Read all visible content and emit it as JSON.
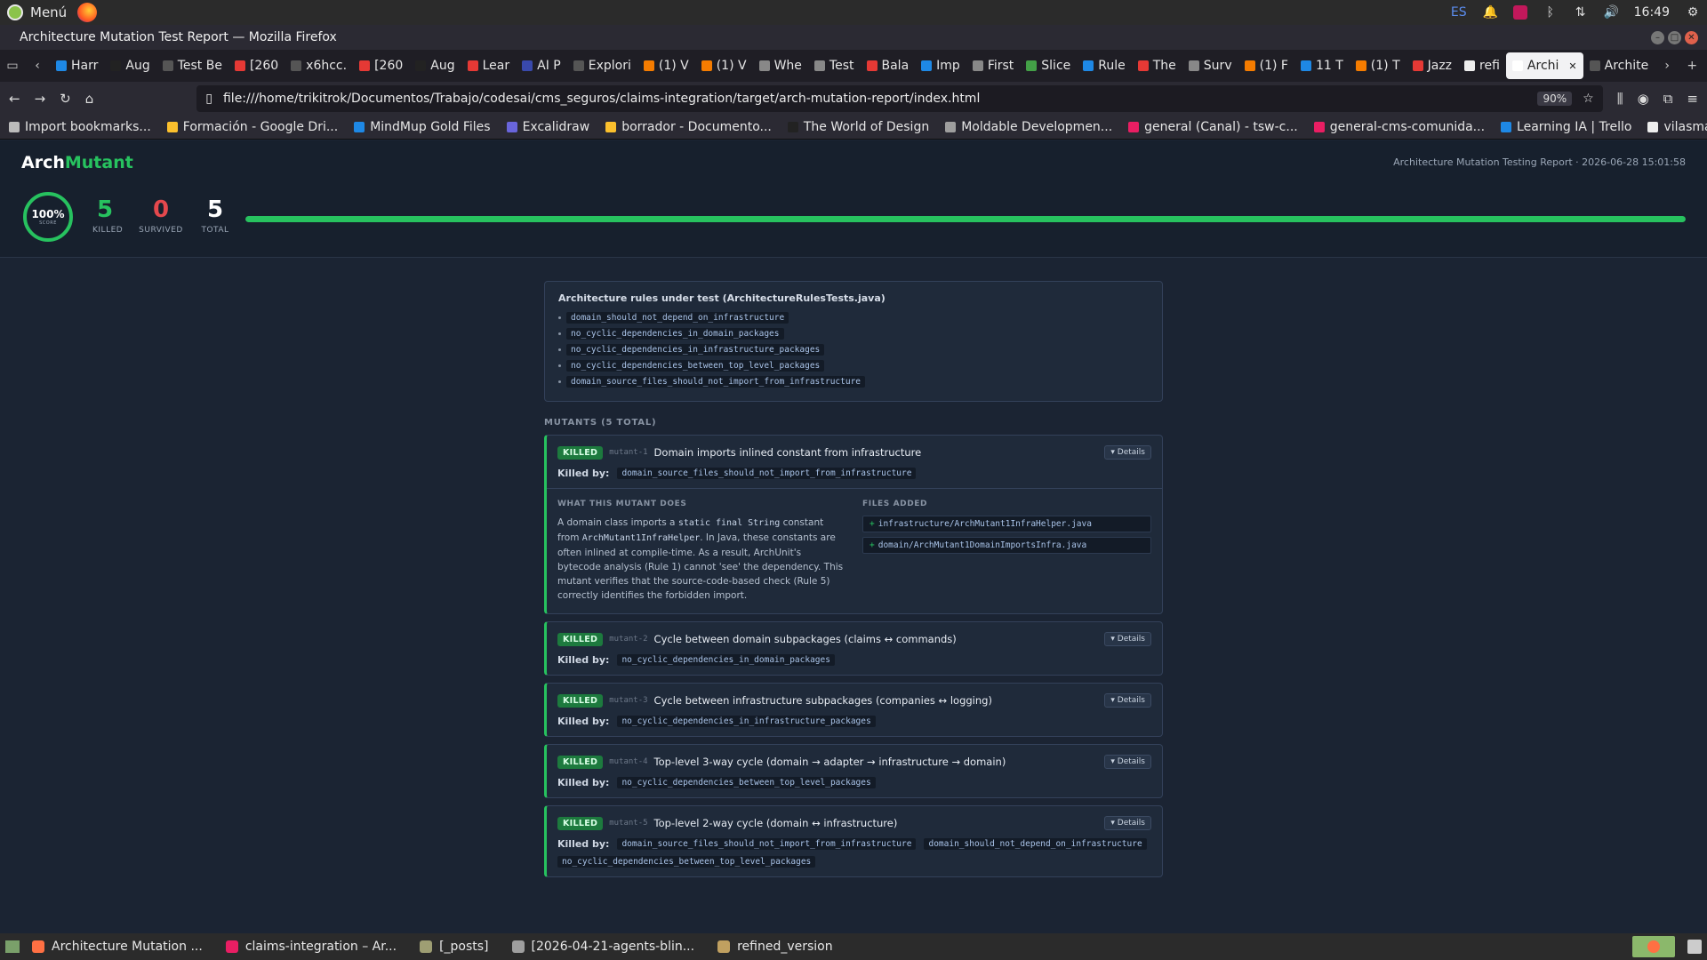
{
  "system": {
    "menu_label": "Menú",
    "keyboard_lang": "ES",
    "clock": "16:49"
  },
  "window": {
    "title": "Architecture Mutation Test Report — Mozilla Firefox"
  },
  "tabs": [
    {
      "label": "Harr",
      "color": "#1e88e5"
    },
    {
      "label": "Aug",
      "color": "#222222"
    },
    {
      "label": "Test Be",
      "color": "#555555"
    },
    {
      "label": "[260",
      "color": "#e53935"
    },
    {
      "label": "x6hcc.",
      "color": "#555555"
    },
    {
      "label": "[260",
      "color": "#e53935"
    },
    {
      "label": "Aug",
      "color": "#222222"
    },
    {
      "label": "Lear",
      "color": "#e53935"
    },
    {
      "label": "AI P",
      "color": "#3949ab"
    },
    {
      "label": "Explori",
      "color": "#555555"
    },
    {
      "label": "(1) V",
      "color": "#f57c00"
    },
    {
      "label": "(1) V",
      "color": "#f57c00"
    },
    {
      "label": "Whe",
      "color": "#888888"
    },
    {
      "label": "Test",
      "color": "#888888"
    },
    {
      "label": "Bala",
      "color": "#e53935"
    },
    {
      "label": "Imp",
      "color": "#1e88e5"
    },
    {
      "label": "First",
      "color": "#888888"
    },
    {
      "label": "Slice",
      "color": "#43a047"
    },
    {
      "label": "Rule",
      "color": "#1e88e5"
    },
    {
      "label": "The",
      "color": "#e53935"
    },
    {
      "label": "Surv",
      "color": "#888888"
    },
    {
      "label": "(1) F",
      "color": "#f57c00"
    },
    {
      "label": "11 T",
      "color": "#1e88e5"
    },
    {
      "label": "(1) T",
      "color": "#f57c00"
    },
    {
      "label": "Jazz",
      "color": "#e53935"
    },
    {
      "label": "refi",
      "color": "#eeeeee"
    },
    {
      "label": "Archi",
      "color": "#ffffff",
      "active": true
    },
    {
      "label": "Archite",
      "color": "#555555"
    }
  ],
  "navbar": {
    "url": "file:///home/trikitrok/Documentos/Trabajo/codesai/cms_seguros/claims-integration/target/arch-mutation-report/index.html",
    "zoom": "90%"
  },
  "bookmarks": [
    {
      "label": "Import bookmarks...",
      "color": "#bbbbbb"
    },
    {
      "label": "Formación - Google Dri...",
      "color": "#fbc02d"
    },
    {
      "label": "MindMup Gold Files",
      "color": "#1e88e5"
    },
    {
      "label": "Excalidraw",
      "color": "#6965db"
    },
    {
      "label": "borrador - Documento...",
      "color": "#fbc02d"
    },
    {
      "label": "The World of Design",
      "color": "#222222"
    },
    {
      "label": "Moldable Developmen...",
      "color": "#9e9e9e"
    },
    {
      "label": "general (Canal) - tsw-c...",
      "color": "#e91e63"
    },
    {
      "label": "general-cms-comunida...",
      "color": "#e91e63"
    },
    {
      "label": "Learning IA | Trello",
      "color": "#1e88e5"
    },
    {
      "label": "vilasmaciel/cosmos-ex...",
      "color": "#eeeeee"
    }
  ],
  "report": {
    "brand_main": "Arch",
    "brand_accent": "Mutant",
    "meta": "Architecture Mutation Testing Report · 2026-06-28 15:01:58",
    "score": "100%",
    "score_label": "SCORE",
    "score_fraction": 1.0,
    "stats": [
      {
        "value": "5",
        "label": "KILLED",
        "color": "#27c25f"
      },
      {
        "value": "0",
        "label": "SURVIVED",
        "color": "#e5484d"
      },
      {
        "value": "5",
        "label": "TOTAL",
        "color": "#ffffff"
      }
    ],
    "accent_color": "#27c25f"
  },
  "rules": {
    "title": "Architecture rules under test (ArchitectureRulesTests.java)",
    "items": [
      "domain_should_not_depend_on_infrastructure",
      "no_cyclic_dependencies_in_domain_packages",
      "no_cyclic_dependencies_in_infrastructure_packages",
      "no_cyclic_dependencies_between_top_level_packages",
      "domain_source_files_should_not_import_from_infrastructure"
    ]
  },
  "mutants_heading": "MUTANTS (5 TOTAL)",
  "killed_by_label": "Killed by:",
  "details_label": "▾ Details",
  "mutants": [
    {
      "status": "KILLED",
      "id": "mutant-1",
      "title": "Domain imports inlined constant from infrastructure",
      "killed_by": [
        "domain_source_files_should_not_import_from_infrastructure"
      ],
      "expanded": true,
      "what_title": "WHAT THIS MUTANT DOES",
      "desc_1": "A domain class imports a ",
      "desc_code_1": "static final String",
      "desc_2": " constant from ",
      "desc_code_2": "ArchMutant1InfraHelper",
      "desc_3": ". In Java, these constants are often inlined at compile-time. As a result, ArchUnit's bytecode analysis (Rule 1) cannot 'see' the dependency. This mutant verifies that the source-code-based check (Rule 5) correctly identifies the forbidden import.",
      "files_title": "FILES ADDED",
      "files": [
        "infrastructure/ArchMutant1InfraHelper.java",
        "domain/ArchMutant1DomainImportsInfra.java"
      ]
    },
    {
      "status": "KILLED",
      "id": "mutant-2",
      "title": "Cycle between domain subpackages (claims ↔ commands)",
      "killed_by": [
        "no_cyclic_dependencies_in_domain_packages"
      ]
    },
    {
      "status": "KILLED",
      "id": "mutant-3",
      "title": "Cycle between infrastructure subpackages (companies ↔ logging)",
      "killed_by": [
        "no_cyclic_dependencies_in_infrastructure_packages"
      ]
    },
    {
      "status": "KILLED",
      "id": "mutant-4",
      "title": "Top-level 3-way cycle (domain → adapter → infrastructure → domain)",
      "killed_by": [
        "no_cyclic_dependencies_between_top_level_packages"
      ]
    },
    {
      "status": "KILLED",
      "id": "mutant-5",
      "title": "Top-level 2-way cycle (domain ↔ infrastructure)",
      "killed_by": [
        "domain_source_files_should_not_import_from_infrastructure",
        "domain_should_not_depend_on_infrastructure",
        "no_cyclic_dependencies_between_top_level_packages"
      ]
    }
  ],
  "taskbar": [
    {
      "label": "Architecture Mutation ...",
      "color": "#ff7043"
    },
    {
      "label": "claims-integration – Ar...",
      "color": "#e91e63"
    },
    {
      "label": "[_posts]",
      "color": "#9e9e73"
    },
    {
      "label": "[2026-04-21-agents-blin...",
      "color": "#9e9e9e"
    },
    {
      "label": "refined_version",
      "color": "#c0a060"
    }
  ]
}
